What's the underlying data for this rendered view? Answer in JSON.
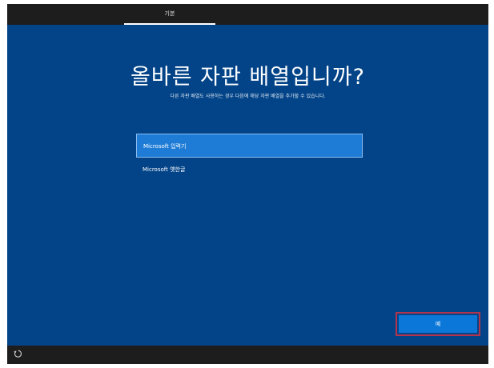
{
  "header": {
    "tab_label": "기본"
  },
  "main": {
    "title": "올바른 자판 배열입니까?",
    "subtitle": "다른 자판 배열도 사용하는 경우 다음에 해당 자판 배열을 추가할 수 있습니다.",
    "layouts": [
      {
        "label": "Microsoft 입력기",
        "selected": true
      },
      {
        "label": "Microsoft 옛한글",
        "selected": false
      }
    ]
  },
  "footer": {
    "yes_label": "예",
    "accessibility_icon": "ease-of-access-icon"
  },
  "colors": {
    "background": "#034488",
    "selected_item": "#1e7cd6",
    "primary_button": "#0b78d9",
    "highlight_border": "#b3344e",
    "bars": "#1d1d1d"
  }
}
